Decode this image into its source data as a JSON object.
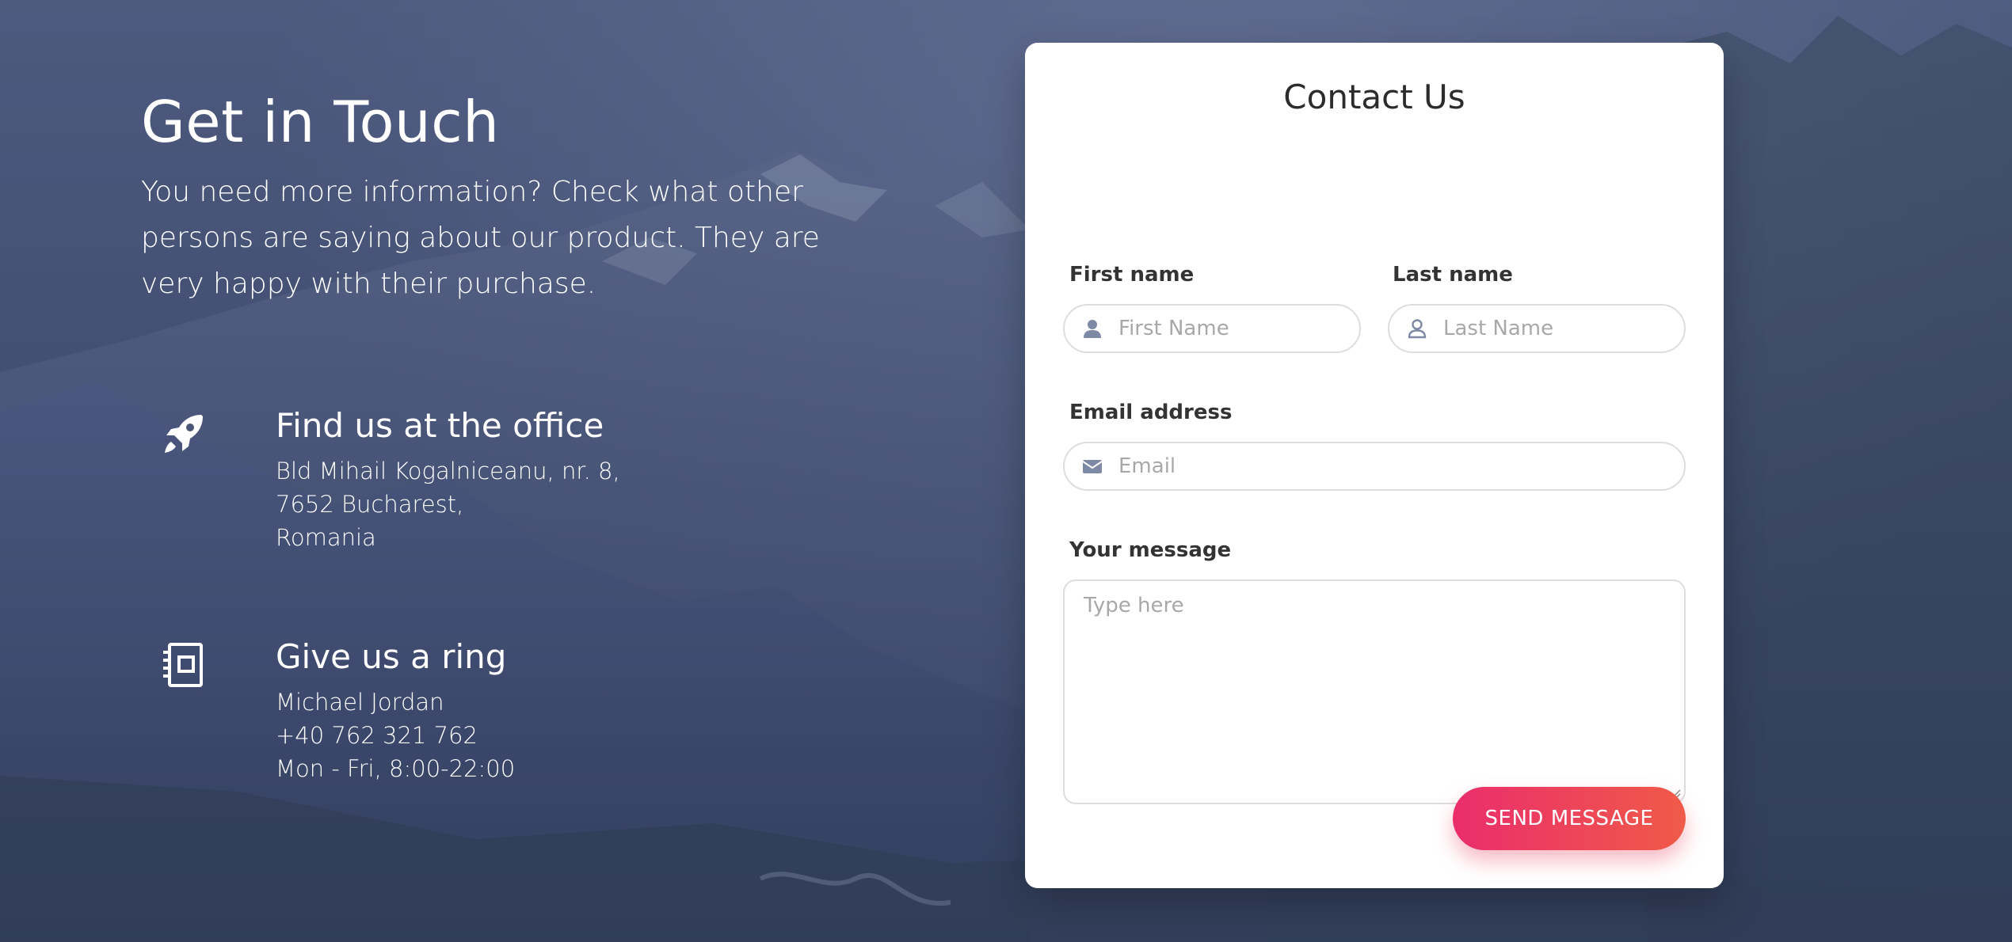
{
  "left": {
    "title": "Get in Touch",
    "lead": "You need more information? Check what other persons are saying about our product. They are very happy with their purchase.",
    "office": {
      "icon": "rocket-icon",
      "title": "Find us at the office",
      "lines": [
        "Bld Mihail Kogalniceanu, nr. 8,",
        "7652 Bucharest,",
        "Romania"
      ]
    },
    "ring": {
      "icon": "contact-book-icon",
      "title": "Give us a ring",
      "lines": [
        "Michael Jordan",
        "+40 762 321 762",
        "Mon - Fri, 8:00-22:00"
      ]
    }
  },
  "form": {
    "title": "Contact Us",
    "first_name": {
      "label": "First name",
      "placeholder": "First Name",
      "icon": "user-icon"
    },
    "last_name": {
      "label": "Last name",
      "placeholder": "Last Name",
      "icon": "user-outline-icon"
    },
    "email": {
      "label": "Email address",
      "placeholder": "Email",
      "icon": "envelope-icon"
    },
    "message": {
      "label": "Your message",
      "placeholder": "Type here"
    },
    "submit_label": "SEND MESSAGE"
  },
  "colors": {
    "button_start": "#ea2d6c",
    "button_end": "#f05a48",
    "overlay": "#37446e"
  }
}
